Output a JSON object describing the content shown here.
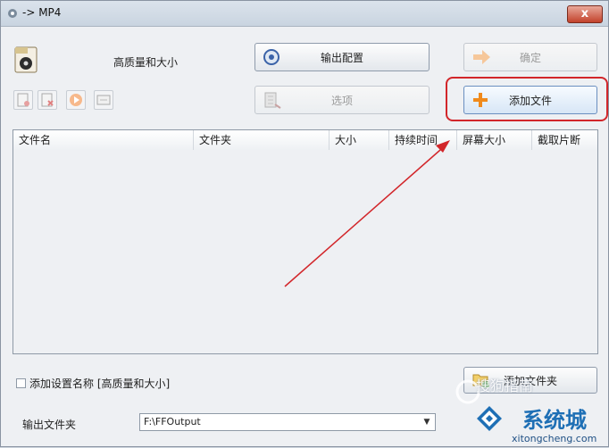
{
  "window": {
    "title": "-> MP4",
    "close_label": "x"
  },
  "preset": {
    "label": "高质量和大小"
  },
  "buttons": {
    "output_config": "输出配置",
    "confirm": "确定",
    "options": "选项",
    "add_file": "添加文件",
    "add_folder": "添加文件夹"
  },
  "table": {
    "columns": [
      "文件名",
      "文件夹",
      "大小",
      "持续时间",
      "屏幕大小",
      "截取片断"
    ],
    "rows": []
  },
  "checkbox": {
    "label": "添加设置名称 [高质量和大小]",
    "checked": false
  },
  "output": {
    "label": "输出文件夹",
    "value": "F:\\FFOutput"
  },
  "watermark": {
    "sogou": "搜狗指南",
    "brand": "系统城",
    "site": "xitongcheng.com"
  },
  "colors": {
    "highlight": "#d2262a",
    "arrow": "#d2262a",
    "accent_orange": "#f08a1c"
  }
}
